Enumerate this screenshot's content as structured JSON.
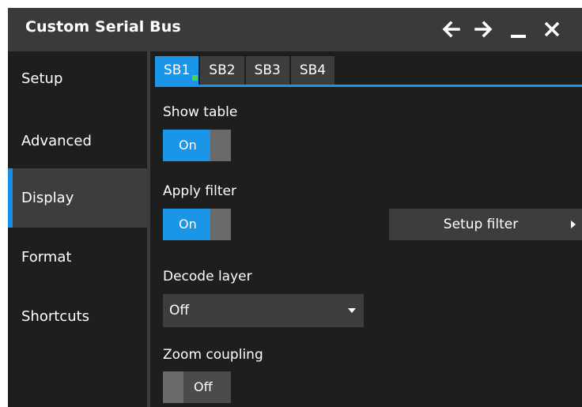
{
  "window": {
    "title": "Custom Serial Bus",
    "controls": [
      "arrow-left-icon",
      "arrow-right-icon",
      "minimize-icon",
      "close-icon"
    ]
  },
  "sidebar": {
    "items": [
      {
        "label": "Setup",
        "active": false
      },
      {
        "label": "Advanced",
        "active": false
      },
      {
        "label": "Display",
        "active": true
      },
      {
        "label": "Format",
        "active": false
      },
      {
        "label": "Shortcuts",
        "active": false
      }
    ]
  },
  "tabs": [
    {
      "label": "SB1",
      "active": true
    },
    {
      "label": "SB2",
      "active": false
    },
    {
      "label": "SB3",
      "active": false
    },
    {
      "label": "SB4",
      "active": false
    }
  ],
  "display": {
    "show_table": {
      "label": "Show table",
      "value": "On"
    },
    "apply_filter": {
      "label": "Apply filter",
      "value": "On"
    },
    "setup_filter_button": "Setup filter",
    "decode_layer": {
      "label": "Decode layer",
      "value": "Off"
    },
    "zoom_coupling": {
      "label": "Zoom coupling",
      "value": "Off"
    }
  },
  "colors": {
    "accent": "#1a95e8",
    "background": "#1e1e1e",
    "panel": "#3d3d3d",
    "indicator": "#49d649"
  }
}
